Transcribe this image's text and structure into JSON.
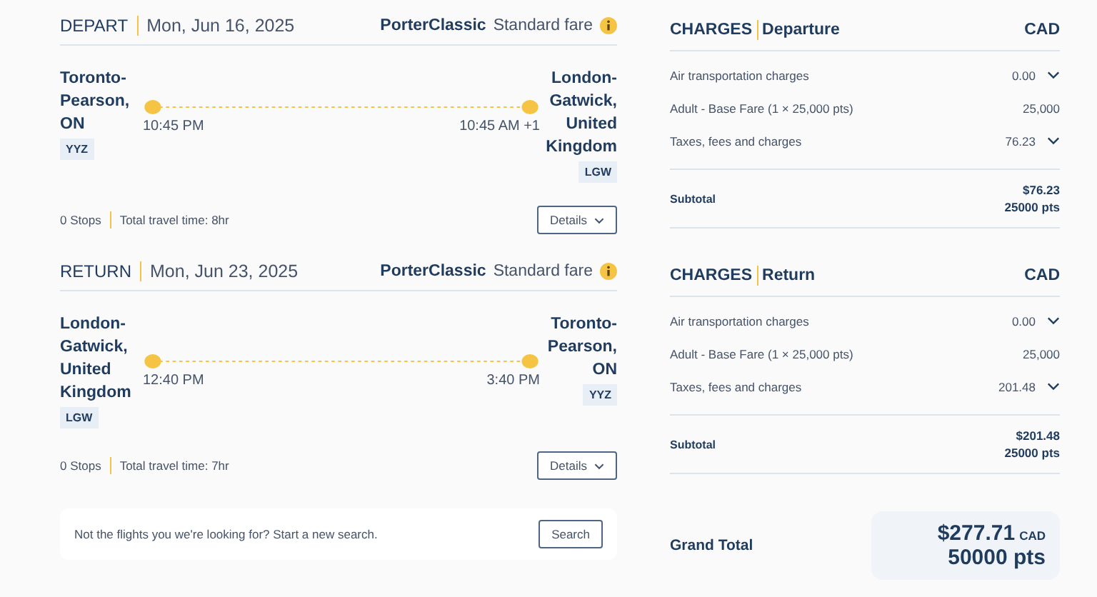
{
  "flights": [
    {
      "direction": "DEPART",
      "date": "Mon, Jun 16, 2025",
      "brand": "PorterClassic",
      "fare": "Standard fare",
      "origin": {
        "city": "Toronto-Pearson, ON",
        "code": "YYZ"
      },
      "departure_time": "10:45 PM",
      "arrival_time": "10:45 AM +1",
      "destination": {
        "city": "London-Gatwick, United Kingdom",
        "code": "LGW"
      },
      "stops": "0 Stops",
      "travel_time": "Total travel time: 8hr",
      "details_button": "Details"
    },
    {
      "direction": "RETURN",
      "date": "Mon, Jun 23, 2025",
      "brand": "PorterClassic",
      "fare": "Standard fare",
      "origin": {
        "city": "London-Gatwick, United Kingdom",
        "code": "LGW"
      },
      "departure_time": "12:40 PM",
      "arrival_time": "3:40 PM",
      "destination": {
        "city": "Toronto-Pearson, ON",
        "code": "YYZ"
      },
      "stops": "0 Stops",
      "travel_time": "Total travel time: 7hr",
      "details_button": "Details"
    }
  ],
  "new_search": {
    "text": "Not the flights you we're looking for? Start a new search.",
    "button": "Search"
  },
  "charges": [
    {
      "title": "CHARGES",
      "leg": "Departure",
      "currency": "CAD",
      "rows": [
        {
          "label": "Air transportation charges",
          "value": "0.00",
          "expandable": true
        },
        {
          "label": "Adult - Base Fare (1 × 25,000 pts)",
          "value": "25,000",
          "expandable": false
        },
        {
          "label": "Taxes, fees and charges",
          "value": "76.23",
          "expandable": true
        }
      ],
      "subtotal_label": "Subtotal",
      "subtotal_amount": "$76.23",
      "subtotal_points": "25000 pts"
    },
    {
      "title": "CHARGES",
      "leg": "Return",
      "currency": "CAD",
      "rows": [
        {
          "label": "Air transportation charges",
          "value": "0.00",
          "expandable": true
        },
        {
          "label": "Adult - Base Fare (1 × 25,000 pts)",
          "value": "25,000",
          "expandable": false
        },
        {
          "label": "Taxes, fees and charges",
          "value": "201.48",
          "expandable": true
        }
      ],
      "subtotal_label": "Subtotal",
      "subtotal_amount": "$201.48",
      "subtotal_points": "25000 pts"
    }
  ],
  "grand_total": {
    "label": "Grand Total",
    "amount": "$277.71",
    "currency": "CAD",
    "points": "50000 pts"
  }
}
